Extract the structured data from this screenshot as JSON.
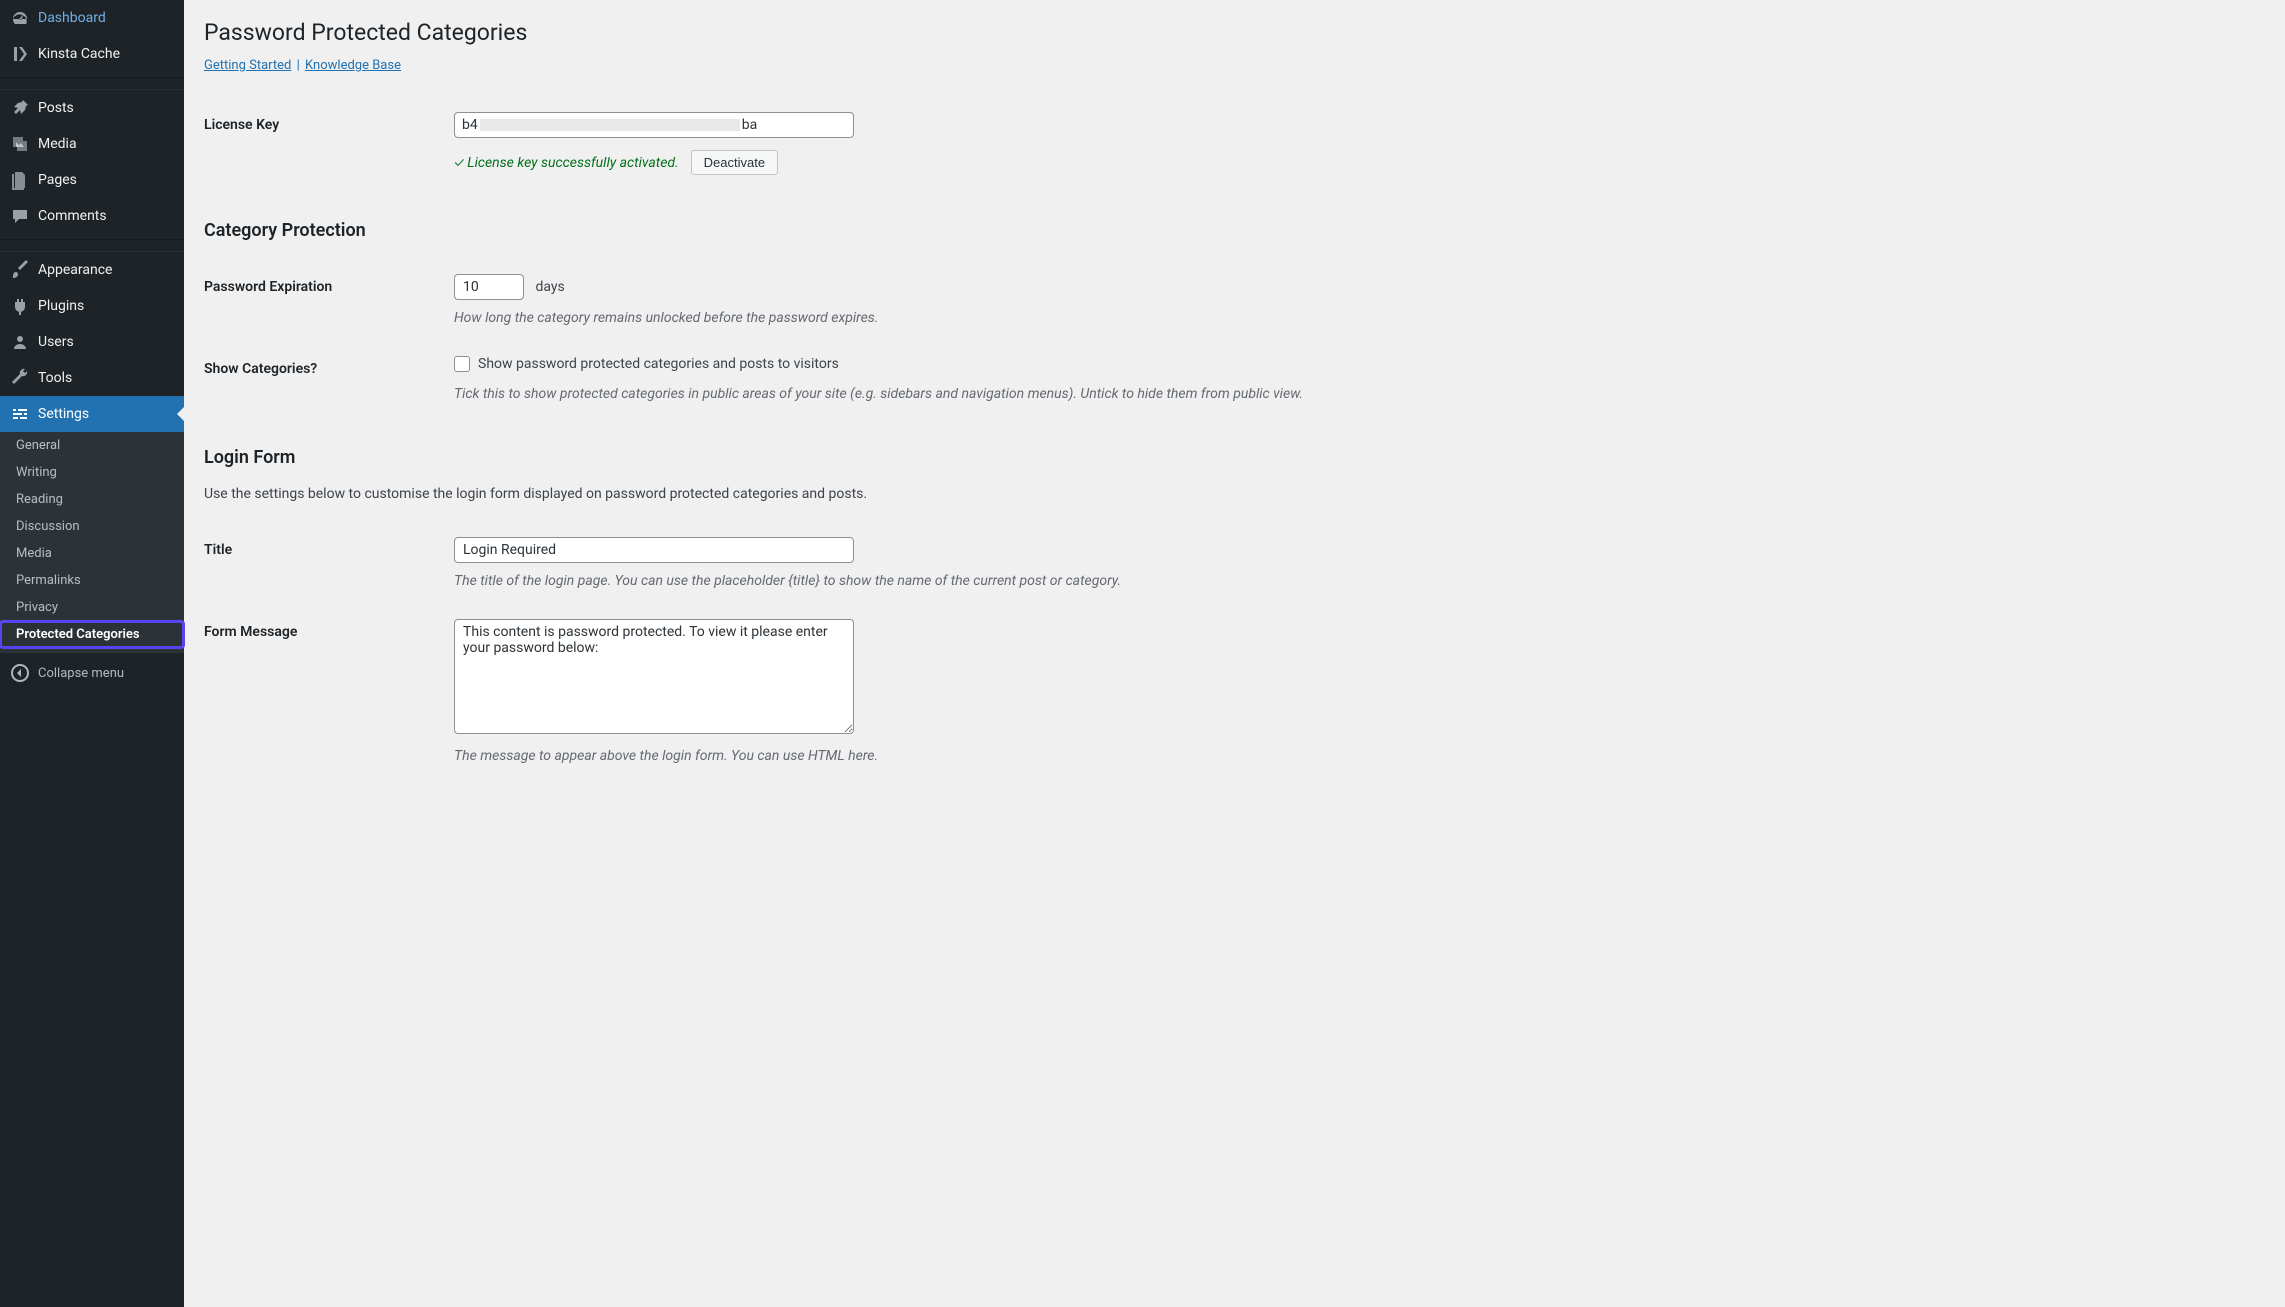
{
  "page": {
    "title": "Password Protected Categories",
    "links": {
      "getting_started": "Getting Started",
      "knowledge_base": "Knowledge Base",
      "separator": "|"
    }
  },
  "sidebar": {
    "dashboard": "Dashboard",
    "kinsta_cache": "Kinsta Cache",
    "posts": "Posts",
    "media": "Media",
    "pages": "Pages",
    "comments": "Comments",
    "appearance": "Appearance",
    "plugins": "Plugins",
    "users": "Users",
    "tools": "Tools",
    "settings": "Settings",
    "submenu": {
      "general": "General",
      "writing": "Writing",
      "reading": "Reading",
      "discussion": "Discussion",
      "media": "Media",
      "permalinks": "Permalinks",
      "privacy": "Privacy",
      "protected_categories": "Protected Categories"
    },
    "collapse": "Collapse menu"
  },
  "license": {
    "label": "License Key",
    "prefix": "b4",
    "suffix": "ba",
    "status_text": "✓ License key successfully activated.",
    "deactivate_label": "Deactivate"
  },
  "category_protection": {
    "heading": "Category Protection",
    "expiration_label": "Password Expiration",
    "expiration_value": "10",
    "expiration_unit": "days",
    "expiration_desc": "How long the category remains unlocked before the password expires.",
    "show_categories_label": "Show Categories?",
    "show_categories_checkbox_label": "Show password protected categories and posts to visitors",
    "show_categories_desc": "Tick this to show protected categories in public areas of your site (e.g. sidebars and navigation menus). Untick to hide them from public view."
  },
  "login_form": {
    "heading": "Login Form",
    "intro": "Use the settings below to customise the login form displayed on password protected categories and posts.",
    "title_label": "Title",
    "title_value": "Login Required",
    "title_desc": "The title of the login page. You can use the placeholder {title} to show the name of the current post or category.",
    "message_label": "Form Message",
    "message_value": "This content is password protected. To view it please enter your password below:",
    "message_desc": "The message to appear above the login form. You can use HTML here."
  }
}
